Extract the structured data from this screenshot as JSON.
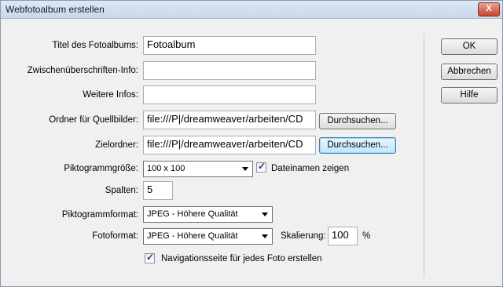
{
  "window": {
    "title": "Webfotoalbum erstellen",
    "close_symbol": "X"
  },
  "fields": {
    "titel": {
      "label": "Titel des Fotoalbums:",
      "value": "Fotoalbum"
    },
    "zwischen": {
      "label": "Zwischenüberschriften-Info:",
      "value": ""
    },
    "weitere": {
      "label": "Weitere Infos:",
      "value": ""
    },
    "quellordner": {
      "label": "Ordner für Quellbilder:",
      "value": "file:///P|/dreamweaver/arbeiten/CD",
      "browse": "Durchsuchen..."
    },
    "zielordner": {
      "label": "Zielordner:",
      "value": "file:///P|/dreamweaver/arbeiten/CD",
      "browse": "Durchsuchen..."
    },
    "pikto_groesse": {
      "label": "Piktogrammgröße:",
      "value": "100 x 100"
    },
    "dateinamen": {
      "label": "Dateinamen zeigen",
      "checked": true
    },
    "spalten": {
      "label": "Spalten:",
      "value": "5"
    },
    "pikto_format": {
      "label": "Piktogrammformat:",
      "value": "JPEG - Höhere Qualität"
    },
    "foto_format": {
      "label": "Fotoformat:",
      "value": "JPEG - Höhere Qualität"
    },
    "skalierung": {
      "label": "Skalierung:",
      "value": "100",
      "unit": "%"
    },
    "navigation": {
      "label": "Navigationsseite für jedes Foto erstellen",
      "checked": true
    }
  },
  "buttons": {
    "ok": "OK",
    "abbrechen": "Abbrechen",
    "hilfe": "Hilfe"
  },
  "checkmark": "✓"
}
